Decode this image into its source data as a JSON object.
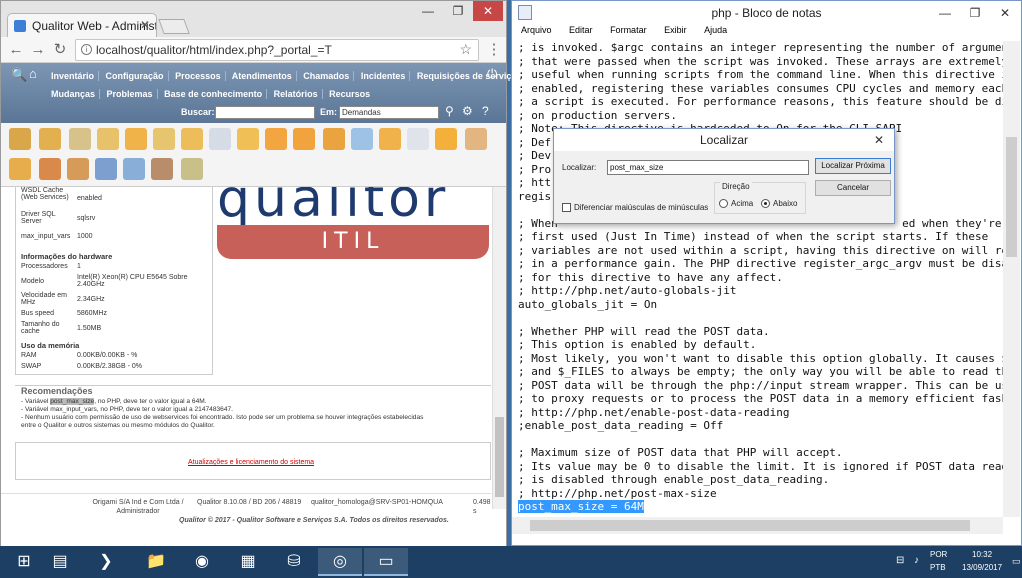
{
  "chrome": {
    "tab_title": "Qualitor Web - Administ",
    "url": "localhost/qualitor/html/index.php?_portal_=T",
    "nav_row1": [
      "Inventário",
      "Configuração",
      "Processos",
      "Atendimentos",
      "Chamados",
      "Incidentes",
      "Requisições de serviço"
    ],
    "nav_row2": [
      "Mudanças",
      "Problemas",
      "Base de conhecimento",
      "Relatórios",
      "Recursos"
    ],
    "search_label": "Buscar:",
    "in_label": "Em:",
    "in_value": "Demandas",
    "info_rows": [
      {
        "k": "WSDL Cache (Web Services)",
        "v": "enabled"
      },
      {
        "k": "Driver SQL Server",
        "v": "sqlsrv"
      },
      {
        "k": "max_input_vars",
        "v": "1000"
      }
    ],
    "hw_title": "Informações do hardware",
    "hw_rows": [
      {
        "k": "Processadores",
        "v": "1"
      },
      {
        "k": "Modelo",
        "v": "Intel(R) Xeon(R) CPU E5645 Sobre 2.40GHz"
      },
      {
        "k": "Velocidade em MHz",
        "v": "2.34GHz"
      },
      {
        "k": "Bus speed",
        "v": "5860MHz"
      },
      {
        "k": "Tamanho do cache",
        "v": "1.50MB"
      }
    ],
    "mem_title": "Uso da memória",
    "mem_rows": [
      {
        "k": "RAM",
        "v": "0.00KB/0.00KB - %"
      },
      {
        "k": "SWAP",
        "v": "0.00KB/2.38GB - 0%"
      }
    ],
    "logo_word": "qualitor",
    "logo_itil": "ITIL",
    "reco_title": "Recomendações",
    "reco_line1_pre": "- Variável ",
    "reco_line1_hl": "post_max_size",
    "reco_line1_post": ", no PHP, deve ter o valor igual a 64M.",
    "reco_line2": "- Variável max_input_vars, no PHP, deve ter o valor igual a 2147483647.",
    "reco_line3": "- Nenhum usuário com permissão de uso de webservices foi encontrado. Isto pode ser um problema se houver integrações estabelecidas",
    "reco_line4": "entre o Qualitor e outros sistemas ou mesmo módulos do Qualitor.",
    "reco_link": "Atualizações e licenciamento do sistema",
    "footer_company": "Origami S/A Ind e Com Ltda / Administrador",
    "footer_version": "Qualitor 8.10.08 / BD 206 / 48819",
    "footer_server": "qualitor_homologa@SRV-SP01-HOMQUA",
    "footer_time": "0.498 s",
    "footer_copyright": "Qualitor © 2017 - Qualitor Software e Serviços S.A. Todos os direitos reservados."
  },
  "notepad": {
    "title": "php - Bloco de notas",
    "menu": [
      "Arquivo",
      "Editar",
      "Formatar",
      "Exibir",
      "Ajuda"
    ],
    "lines": [
      "; is invoked. $argc contains an integer representing the number of arguments",
      "; that were passed when the script was invoked. These arrays are extremely",
      "; useful when running scripts from the command line. When this directive is",
      "; enabled, registering these variables consumes CPU cycles and memory each time",
      "; a script is executed. For performance reasons, this feature should be disabled",
      "; on production servers.",
      "; Note: This directive is hardcoded to On for the CLI SAPI",
      "; Def",
      "; Dev",
      "; Pro",
      "; htt",
      "regis",
      "",
      "; When                                                    ed when they're",
      "; first used (Just In Time) instead of when the script starts. If these",
      "; variables are not used within a script, having this directive on will result",
      "; in a performance gain. The PHP directive register_argc_argv must be disabled",
      "; for this directive to have any affect.",
      "; http://php.net/auto-globals-jit",
      "auto_globals_jit = On",
      "",
      "; Whether PHP will read the POST data.",
      "; This option is enabled by default.",
      "; Most likely, you won't want to disable this option globally. It causes $_POST",
      "; and $_FILES to always be empty; the only way you will be able to read the",
      "; POST data will be through the php://input stream wrapper. This can be useful",
      "; to proxy requests or to process the POST data in a memory efficient fashion.",
      "; http://php.net/enable-post-data-reading",
      ";enable_post_data_reading = Off",
      "",
      "; Maximum size of POST data that PHP will accept.",
      "; Its value may be 0 to disable the limit. It is ignored if POST data reading",
      "; is disabled through enable_post_data_reading.",
      "; http://php.net/post-max-size"
    ],
    "selected_line": "post_max_size = 64M"
  },
  "find_dialog": {
    "title": "Localizar",
    "find_label": "Localizar:",
    "find_value": "post_max_size",
    "find_next": "Localizar Próxima",
    "cancel": "Cancelar",
    "direction_label": "Direção",
    "up_label": "Acima",
    "down_label": "Abaixo",
    "direction_selected": "Abaixo",
    "match_case_label": "Diferenciar maiúsculas de minúsculas",
    "match_case_checked": false
  },
  "taskbar": {
    "lang1": "POR",
    "lang2": "PTB",
    "time": "10:32",
    "date": "13/09/2017"
  }
}
